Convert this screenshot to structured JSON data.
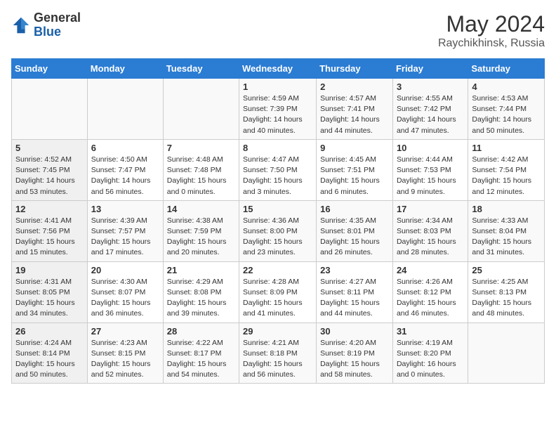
{
  "header": {
    "logo_line1": "General",
    "logo_line2": "Blue",
    "month_title": "May 2024",
    "location": "Raychikhinsk, Russia"
  },
  "weekdays": [
    "Sunday",
    "Monday",
    "Tuesday",
    "Wednesday",
    "Thursday",
    "Friday",
    "Saturday"
  ],
  "weeks": [
    [
      {
        "day": "",
        "info": ""
      },
      {
        "day": "",
        "info": ""
      },
      {
        "day": "",
        "info": ""
      },
      {
        "day": "1",
        "info": "Sunrise: 4:59 AM\nSunset: 7:39 PM\nDaylight: 14 hours\nand 40 minutes."
      },
      {
        "day": "2",
        "info": "Sunrise: 4:57 AM\nSunset: 7:41 PM\nDaylight: 14 hours\nand 44 minutes."
      },
      {
        "day": "3",
        "info": "Sunrise: 4:55 AM\nSunset: 7:42 PM\nDaylight: 14 hours\nand 47 minutes."
      },
      {
        "day": "4",
        "info": "Sunrise: 4:53 AM\nSunset: 7:44 PM\nDaylight: 14 hours\nand 50 minutes."
      }
    ],
    [
      {
        "day": "5",
        "info": "Sunrise: 4:52 AM\nSunset: 7:45 PM\nDaylight: 14 hours\nand 53 minutes."
      },
      {
        "day": "6",
        "info": "Sunrise: 4:50 AM\nSunset: 7:47 PM\nDaylight: 14 hours\nand 56 minutes."
      },
      {
        "day": "7",
        "info": "Sunrise: 4:48 AM\nSunset: 7:48 PM\nDaylight: 15 hours\nand 0 minutes."
      },
      {
        "day": "8",
        "info": "Sunrise: 4:47 AM\nSunset: 7:50 PM\nDaylight: 15 hours\nand 3 minutes."
      },
      {
        "day": "9",
        "info": "Sunrise: 4:45 AM\nSunset: 7:51 PM\nDaylight: 15 hours\nand 6 minutes."
      },
      {
        "day": "10",
        "info": "Sunrise: 4:44 AM\nSunset: 7:53 PM\nDaylight: 15 hours\nand 9 minutes."
      },
      {
        "day": "11",
        "info": "Sunrise: 4:42 AM\nSunset: 7:54 PM\nDaylight: 15 hours\nand 12 minutes."
      }
    ],
    [
      {
        "day": "12",
        "info": "Sunrise: 4:41 AM\nSunset: 7:56 PM\nDaylight: 15 hours\nand 15 minutes."
      },
      {
        "day": "13",
        "info": "Sunrise: 4:39 AM\nSunset: 7:57 PM\nDaylight: 15 hours\nand 17 minutes."
      },
      {
        "day": "14",
        "info": "Sunrise: 4:38 AM\nSunset: 7:59 PM\nDaylight: 15 hours\nand 20 minutes."
      },
      {
        "day": "15",
        "info": "Sunrise: 4:36 AM\nSunset: 8:00 PM\nDaylight: 15 hours\nand 23 minutes."
      },
      {
        "day": "16",
        "info": "Sunrise: 4:35 AM\nSunset: 8:01 PM\nDaylight: 15 hours\nand 26 minutes."
      },
      {
        "day": "17",
        "info": "Sunrise: 4:34 AM\nSunset: 8:03 PM\nDaylight: 15 hours\nand 28 minutes."
      },
      {
        "day": "18",
        "info": "Sunrise: 4:33 AM\nSunset: 8:04 PM\nDaylight: 15 hours\nand 31 minutes."
      }
    ],
    [
      {
        "day": "19",
        "info": "Sunrise: 4:31 AM\nSunset: 8:05 PM\nDaylight: 15 hours\nand 34 minutes."
      },
      {
        "day": "20",
        "info": "Sunrise: 4:30 AM\nSunset: 8:07 PM\nDaylight: 15 hours\nand 36 minutes."
      },
      {
        "day": "21",
        "info": "Sunrise: 4:29 AM\nSunset: 8:08 PM\nDaylight: 15 hours\nand 39 minutes."
      },
      {
        "day": "22",
        "info": "Sunrise: 4:28 AM\nSunset: 8:09 PM\nDaylight: 15 hours\nand 41 minutes."
      },
      {
        "day": "23",
        "info": "Sunrise: 4:27 AM\nSunset: 8:11 PM\nDaylight: 15 hours\nand 44 minutes."
      },
      {
        "day": "24",
        "info": "Sunrise: 4:26 AM\nSunset: 8:12 PM\nDaylight: 15 hours\nand 46 minutes."
      },
      {
        "day": "25",
        "info": "Sunrise: 4:25 AM\nSunset: 8:13 PM\nDaylight: 15 hours\nand 48 minutes."
      }
    ],
    [
      {
        "day": "26",
        "info": "Sunrise: 4:24 AM\nSunset: 8:14 PM\nDaylight: 15 hours\nand 50 minutes."
      },
      {
        "day": "27",
        "info": "Sunrise: 4:23 AM\nSunset: 8:15 PM\nDaylight: 15 hours\nand 52 minutes."
      },
      {
        "day": "28",
        "info": "Sunrise: 4:22 AM\nSunset: 8:17 PM\nDaylight: 15 hours\nand 54 minutes."
      },
      {
        "day": "29",
        "info": "Sunrise: 4:21 AM\nSunset: 8:18 PM\nDaylight: 15 hours\nand 56 minutes."
      },
      {
        "day": "30",
        "info": "Sunrise: 4:20 AM\nSunset: 8:19 PM\nDaylight: 15 hours\nand 58 minutes."
      },
      {
        "day": "31",
        "info": "Sunrise: 4:19 AM\nSunset: 8:20 PM\nDaylight: 16 hours\nand 0 minutes."
      },
      {
        "day": "",
        "info": ""
      }
    ]
  ]
}
